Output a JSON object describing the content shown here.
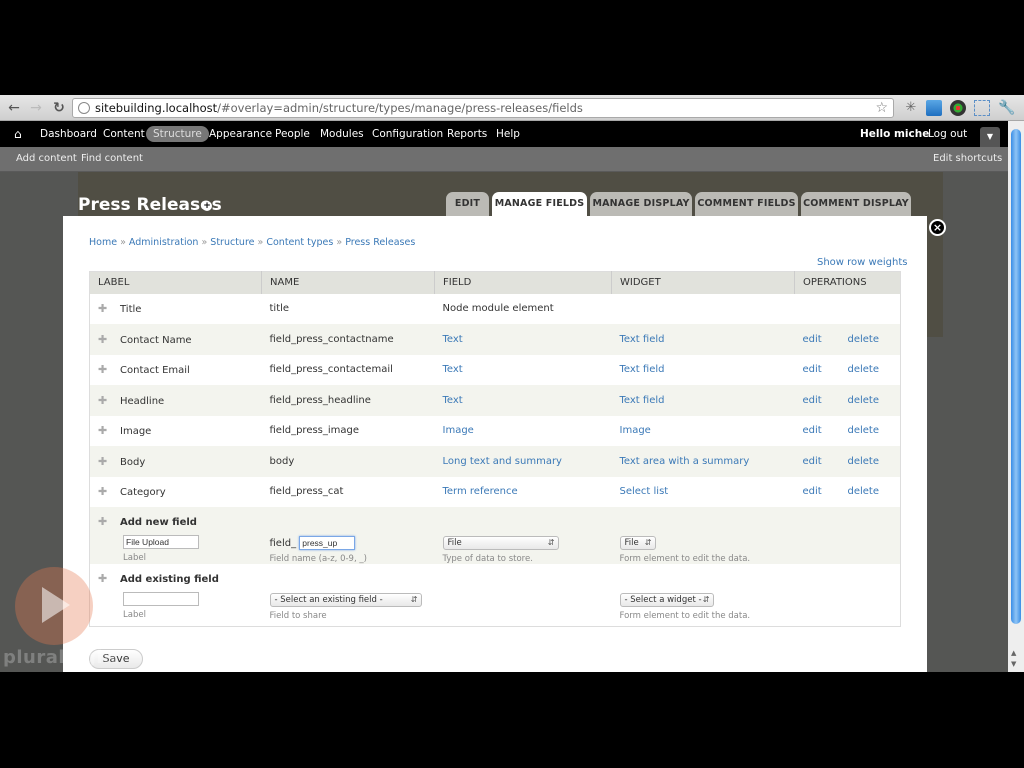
{
  "browser": {
    "url_host": "sitebuilding.localhost",
    "url_path": "/#overlay=admin/structure/types/manage/press-releases/fields"
  },
  "toolbar": {
    "items": [
      "Dashboard",
      "Content",
      "Structure",
      "Appearance",
      "People",
      "Modules",
      "Configuration",
      "Reports",
      "Help"
    ],
    "active": "Structure",
    "greeting": "Hello miche",
    "logout": "Log out"
  },
  "shortcuts": {
    "add_content": "Add content",
    "find_content": "Find content",
    "edit_shortcuts": "Edit shortcuts"
  },
  "overlay": {
    "title": "Press Releases",
    "tabs": [
      "EDIT",
      "MANAGE FIELDS",
      "MANAGE DISPLAY",
      "COMMENT FIELDS",
      "COMMENT DISPLAY"
    ],
    "active_tab": "MANAGE FIELDS",
    "breadcrumb": [
      "Home",
      "Administration",
      "Structure",
      "Content types",
      "Press Releases"
    ],
    "show_row_weights": "Show row weights"
  },
  "table": {
    "headers": [
      "LABEL",
      "NAME",
      "FIELD",
      "WIDGET",
      "OPERATIONS"
    ],
    "rows": [
      {
        "label": "Title",
        "name": "title",
        "field": "Node module element",
        "widget": "",
        "edit": "",
        "delete": ""
      },
      {
        "label": "Contact Name",
        "name": "field_press_contactname",
        "field": "Text",
        "widget": "Text field",
        "edit": "edit",
        "delete": "delete"
      },
      {
        "label": "Contact Email",
        "name": "field_press_contactemail",
        "field": "Text",
        "widget": "Text field",
        "edit": "edit",
        "delete": "delete"
      },
      {
        "label": "Headline",
        "name": "field_press_headline",
        "field": "Text",
        "widget": "Text field",
        "edit": "edit",
        "delete": "delete"
      },
      {
        "label": "Image",
        "name": "field_press_image",
        "field": "Image",
        "widget": "Image",
        "edit": "edit",
        "delete": "delete"
      },
      {
        "label": "Body",
        "name": "body",
        "field": "Long text and summary",
        "widget": "Text area with a summary",
        "edit": "edit",
        "delete": "delete"
      },
      {
        "label": "Category",
        "name": "field_press_cat",
        "field": "Term reference",
        "widget": "Select list",
        "edit": "edit",
        "delete": "delete"
      }
    ],
    "new_field": {
      "title": "Add new field",
      "label_value": "File Upload",
      "label_desc": "Label",
      "name_prefix": "field_",
      "name_value": "press_up",
      "name_desc": "Field name (a-z, 0-9, _)",
      "type_value": "File",
      "type_desc": "Type of data to store.",
      "widget_value": "File",
      "widget_desc": "Form element to edit the data."
    },
    "existing_field": {
      "title": "Add existing field",
      "label_value": "",
      "label_desc": "Label",
      "field_value": "- Select an existing field -",
      "field_desc": "Field to share",
      "widget_value": "- Select a widget -",
      "widget_desc": "Form element to edit the data."
    }
  },
  "save_label": "Save",
  "watermark": "pluralsight"
}
